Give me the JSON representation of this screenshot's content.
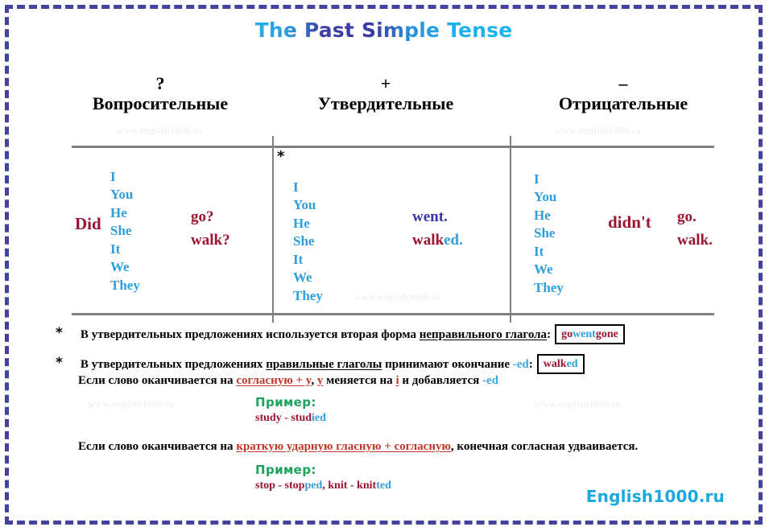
{
  "title": "The Past Simple Tense",
  "columns": [
    {
      "sign": "?",
      "label": "Вопросительные"
    },
    {
      "sign": "+",
      "label": "Утвердительные"
    },
    {
      "sign": "–",
      "label": "Отрицательные"
    }
  ],
  "pronouns": "I\nYou\nHe\nShe\nIt\nWe\nThey",
  "table": {
    "question": {
      "auxiliary": "Did",
      "pronouns": [
        "I",
        "You",
        "He",
        "She",
        "It",
        "We",
        "They"
      ],
      "verbs": [
        "go?",
        "walk?"
      ]
    },
    "affirmative": {
      "star": "*",
      "pronouns": [
        "I",
        "You",
        "He",
        "She",
        "It",
        "We",
        "They"
      ],
      "verb_irregular": "went.",
      "verb_regular_stem": "walk",
      "verb_regular_ending": "ed."
    },
    "negative": {
      "auxiliary": "didn't",
      "pronouns": [
        "I",
        "You",
        "He",
        "She",
        "It",
        "We",
        "They"
      ],
      "verbs": [
        "go.",
        "walk."
      ]
    }
  },
  "notes": {
    "star": "*",
    "note1": {
      "part1": "В утвердительных предложениях используется вторая форма ",
      "underlined": "неправильного глагола",
      "part2": ":",
      "box": {
        "w1": "go",
        "w2": "went",
        "w3": "gone"
      }
    },
    "note2": {
      "part1": "В утвердительных предложениях ",
      "underlined": "правильные глаголы",
      "part2": " принимают окончание ",
      "ending": "-ed",
      "part3": ":",
      "box": {
        "stem": "walk",
        "suffix": "ed"
      }
    },
    "note2b": {
      "part1": "Если слово оканчивается на ",
      "rule": "согласную + y",
      "part2": ", ",
      "letter_y": "y",
      "part3": " меняется на ",
      "letter_i": "i",
      "part4": " и добавляется ",
      "ending": "-ed"
    },
    "example1": {
      "label": "Пример:",
      "stem": "study - stud",
      "suffix": "ied"
    },
    "note3": {
      "part1": "Если слово оканчивается на ",
      "rule": "краткую ударную гласную + согласную",
      "part2": ", конечная согласная удваивается."
    },
    "example2": {
      "label": "Пример:",
      "s1": "stop - stop",
      "b1": "ped",
      "s2": ", knit - knit",
      "b2": "ted"
    }
  },
  "watermarks": [
    "www.english1000.ru",
    "www.english1000.ru",
    "www.english1000.ru",
    "www.english1000.ru",
    "www.english1000.ru"
  ],
  "footer_logo": "English1000.ru",
  "colors": {
    "frame": "#4442a0",
    "title_accent": "#22b0e8",
    "title_deep": "#3f3fa8",
    "pronoun_blue": "#2f9fdc",
    "verb_red": "#9b1430",
    "irregular_navy": "#3a35a8",
    "rule_red": "#c0392b",
    "example_green": "#1aa35a",
    "table_line": "#808080",
    "logo": "#1aa8e0"
  }
}
